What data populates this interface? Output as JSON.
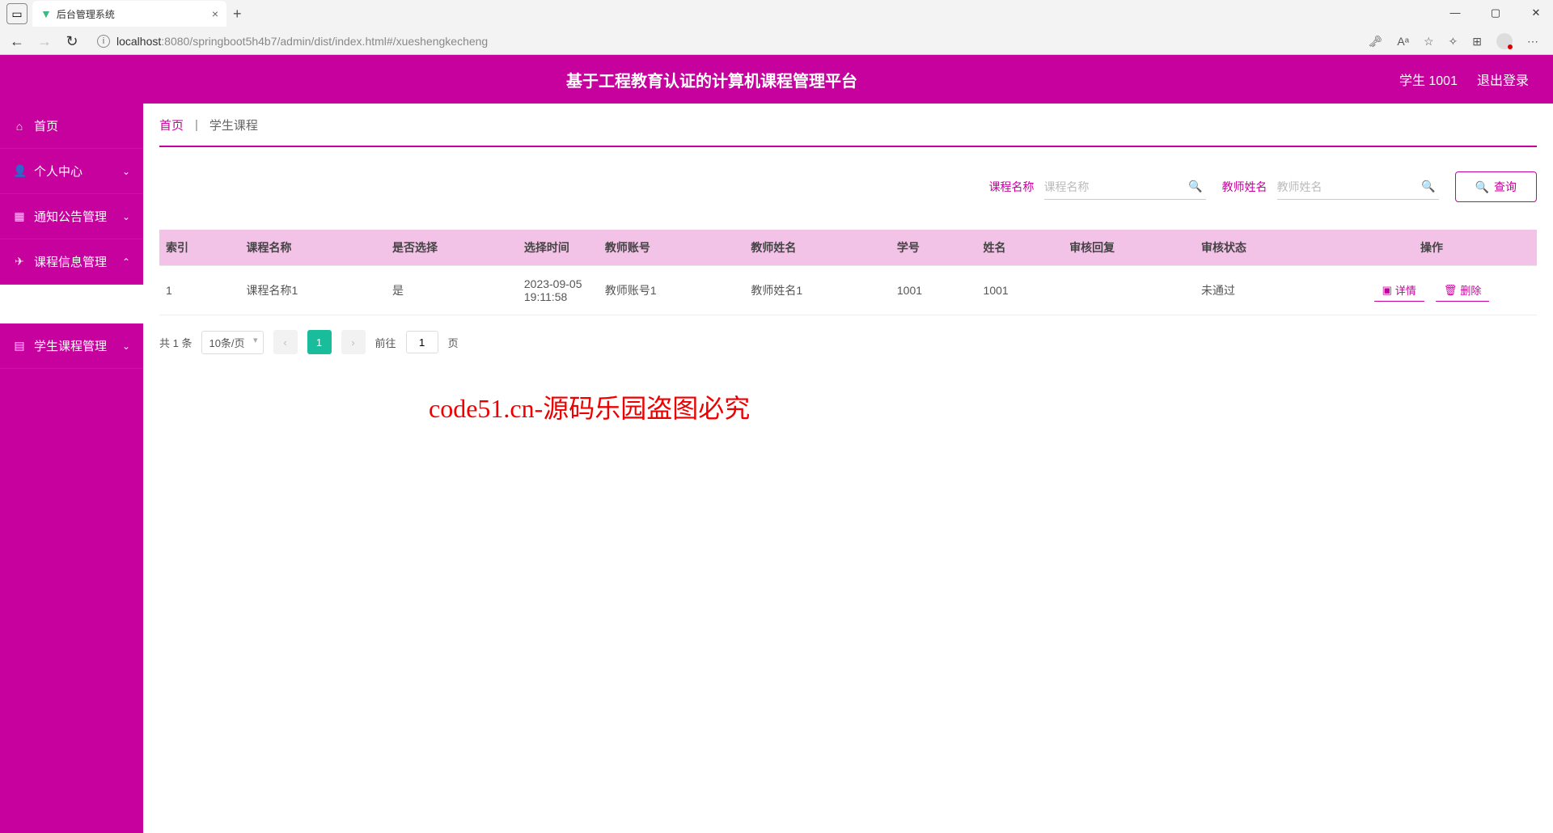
{
  "browser": {
    "tab_title": "后台管理系统",
    "url_host": "localhost",
    "url_path": ":8080/springboot5h4b7/admin/dist/index.html#/xueshengkecheng"
  },
  "header": {
    "title": "基于工程教育认证的计算机课程管理平台",
    "user": "学生 1001",
    "logout": "退出登录"
  },
  "sidebar": {
    "items": [
      {
        "label": "首页",
        "icon": "home"
      },
      {
        "label": "个人中心",
        "icon": "user",
        "chevron": "down"
      },
      {
        "label": "通知公告管理",
        "icon": "doc",
        "chevron": "down"
      },
      {
        "label": "课程信息管理",
        "icon": "send",
        "chevron": "up"
      },
      {
        "label": "学生课程管理",
        "icon": "book",
        "chevron": "down"
      }
    ],
    "submenu_blank": " "
  },
  "breadcrumb": {
    "home": "首页",
    "current": "学生课程"
  },
  "search": {
    "field1_label": "课程名称",
    "field1_placeholder": "课程名称",
    "field2_label": "教师姓名",
    "field2_placeholder": "教师姓名",
    "button": "查询"
  },
  "table": {
    "headers": [
      "索引",
      "课程名称",
      "是否选择",
      "选择时间",
      "教师账号",
      "教师姓名",
      "学号",
      "姓名",
      "审核回复",
      "审核状态",
      "操作"
    ],
    "rows": [
      {
        "index": "1",
        "course_name": "课程名称1",
        "selected": "是",
        "select_time": "2023-09-05 19:11:58",
        "teacher_acct": "教师账号1",
        "teacher_name": "教师姓名1",
        "student_no": "1001",
        "student_name": "1001",
        "review_reply": "",
        "review_status": "未通过"
      }
    ],
    "op_detail": "详情",
    "op_delete": "删除"
  },
  "pagination": {
    "total_text": "共 1 条",
    "page_size": "10条/页",
    "current_page": "1",
    "goto_prefix": "前往",
    "goto_value": "1",
    "goto_suffix": "页"
  },
  "watermark": "code51.cn-源码乐园盗图必究"
}
